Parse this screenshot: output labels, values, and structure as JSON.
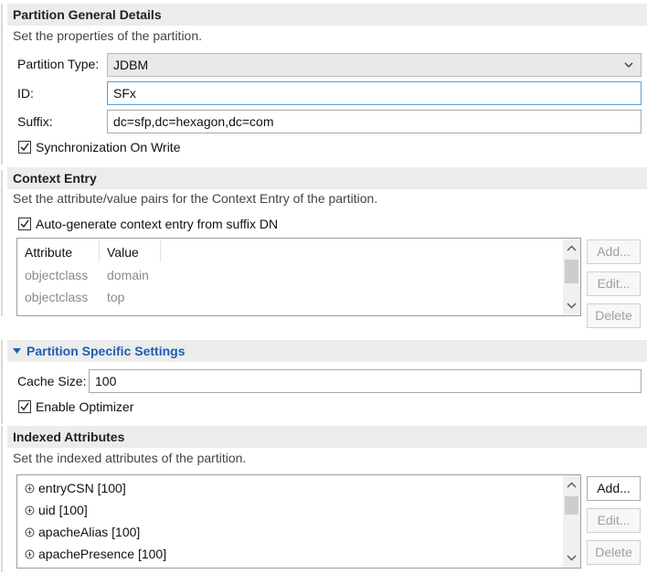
{
  "general": {
    "title": "Partition General Details",
    "description": "Set the properties of the partition.",
    "partition_type_label": "Partition Type:",
    "partition_type_value": "JDBM",
    "id_label": "ID:",
    "id_value": "SFx",
    "suffix_label": "Suffix:",
    "suffix_value": "dc=sfp,dc=hexagon,dc=com",
    "sync_label": "Synchronization On Write",
    "sync_checked": true
  },
  "context_entry": {
    "title": "Context Entry",
    "description": "Set the attribute/value pairs for the Context Entry of the partition.",
    "autogen_label": "Auto-generate context entry from suffix DN",
    "autogen_checked": true,
    "columns": [
      "Attribute",
      "Value"
    ],
    "rows": [
      {
        "attribute": "objectclass",
        "value": "domain"
      },
      {
        "attribute": "objectclass",
        "value": "top"
      }
    ],
    "buttons": {
      "add": "Add...",
      "edit": "Edit...",
      "delete": "Delete"
    }
  },
  "specific": {
    "title": "Partition Specific Settings",
    "expanded": true,
    "cache_label": "Cache Size:",
    "cache_value": "100",
    "optimizer_label": "Enable Optimizer",
    "optimizer_checked": true
  },
  "indexed": {
    "title": "Indexed Attributes",
    "description": "Set the indexed attributes of the partition.",
    "items": [
      "entryCSN [100]",
      "uid [100]",
      "apacheAlias [100]",
      "apachePresence [100]"
    ],
    "buttons": {
      "add": "Add...",
      "edit": "Edit...",
      "delete": "Delete"
    }
  },
  "colors": {
    "accent_blue": "#1a5fb4",
    "focus_border": "#5aa0d8",
    "header_bg": "#ececec"
  }
}
